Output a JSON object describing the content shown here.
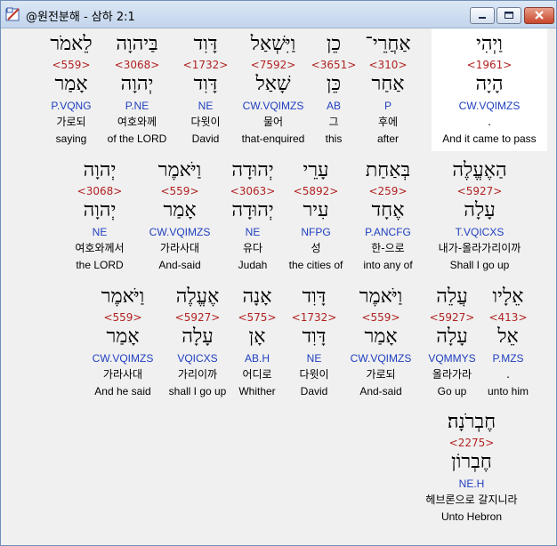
{
  "window": {
    "title": "@원전분해 - 삼하 2:1"
  },
  "icons": {
    "app": "dictionary-pen-icon",
    "minimize": "minimize-icon",
    "maximize": "maximize-icon",
    "close": "close-icon"
  },
  "rows": [
    {
      "words": [
        {
          "heb": "וַיְהִי",
          "num": "<1961>",
          "lex": "הָיָה",
          "morph": "CW.VQIMZS",
          "kor": ".",
          "eng": "And it came to pass",
          "highlight": true
        },
        {
          "heb": "אַחֲרֵי־",
          "num": "<310>",
          "lex": "אַחַר",
          "morph": "P",
          "kor": "후에",
          "eng": "after"
        },
        {
          "heb": "כֵן",
          "num": "<3651>",
          "lex": "כֵּן",
          "morph": "AB",
          "kor": "그",
          "eng": "this"
        },
        {
          "heb": "וַיִּשְׁאַל",
          "num": "<7592>",
          "lex": "שָׁאַל",
          "morph": "CW.VQIMZS",
          "kor": "물어",
          "eng": "that-enquired"
        },
        {
          "heb": "דָּוִד",
          "num": "<1732>",
          "lex": "דָּוִד",
          "morph": "NE",
          "kor": "다윗이",
          "eng": "David"
        },
        {
          "heb": "בַּיהוָה",
          "num": "<3068>",
          "lex": "יְהוָה",
          "morph": "P.NE",
          "kor": "여호와께",
          "eng": "of the LORD"
        },
        {
          "heb": "לֵאמֹר",
          "num": "<559>",
          "lex": "אָמַר",
          "morph": "P.VQNG",
          "kor": "가로되",
          "eng": "saying"
        }
      ]
    },
    {
      "words": [
        {
          "heb": "הַאֶעֱלֶה",
          "num": "<5927>",
          "lex": "עָלָה",
          "morph": "T.VQICXS",
          "kor": "내가-올라가리이까",
          "eng": "Shall I go up"
        },
        {
          "heb": "בְּאַחַת",
          "num": "<259>",
          "lex": "אֶחָד",
          "morph": "P.ANCFG",
          "kor": "한-으로",
          "eng": "into any of"
        },
        {
          "heb": "עָרֵי",
          "num": "<5892>",
          "lex": "עִיר",
          "morph": "NFPG",
          "kor": "성",
          "eng": "the cities of"
        },
        {
          "heb": "יְהוּדָה",
          "num": "<3063>",
          "lex": "יְהוּדָה",
          "morph": "NE",
          "kor": "유다",
          "eng": "Judah"
        },
        {
          "heb": "וַיֹּאמֶר",
          "num": "<559>",
          "lex": "אָמַר",
          "morph": "CW.VQIMZS",
          "kor": "가라사대",
          "eng": "And-said"
        },
        {
          "heb": "יְהוָה",
          "num": "<3068>",
          "lex": "יְהוָה",
          "morph": "NE",
          "kor": "여호와께서",
          "eng": "the LORD"
        }
      ]
    },
    {
      "words": [
        {
          "heb": "אֵלָיו",
          "num": "<413>",
          "lex": "אֵל",
          "morph": "P.MZS",
          "kor": ".",
          "eng": "unto him"
        },
        {
          "heb": "עֲלֵה",
          "num": "<5927>",
          "lex": "עָלָה",
          "morph": "VQMMYS",
          "kor": "올라가라",
          "eng": "Go up"
        },
        {
          "heb": "וַיֹּאמֶר",
          "num": "<559>",
          "lex": "אָמַר",
          "morph": "CW.VQIMZS",
          "kor": "가로되",
          "eng": "And-said"
        },
        {
          "heb": "דָּוִד",
          "num": "<1732>",
          "lex": "דָּוִד",
          "morph": "NE",
          "kor": "다윗이",
          "eng": "David"
        },
        {
          "heb": "אָנָה",
          "num": "<575>",
          "lex": "אָן",
          "morph": "AB.H",
          "kor": "어디로",
          "eng": "Whither"
        },
        {
          "heb": "אֶעֱלֶה",
          "num": "<5927>",
          "lex": "עָלָה",
          "morph": "VQICXS",
          "kor": "가리이까",
          "eng": "shall I go up"
        },
        {
          "heb": "וַיֹּאמֶר",
          "num": "<559>",
          "lex": "אָמַר",
          "morph": "CW.VQIMZS",
          "kor": "가라사대",
          "eng": "And he said"
        }
      ]
    },
    {
      "words": [
        {
          "heb": "חֶבְרֹנָה׃",
          "num": "<2275>",
          "lex": "חֶבְרוֹן",
          "morph": "NE.H",
          "kor": "헤브론으로 갈지니라",
          "eng": "Unto Hebron"
        }
      ]
    }
  ]
}
